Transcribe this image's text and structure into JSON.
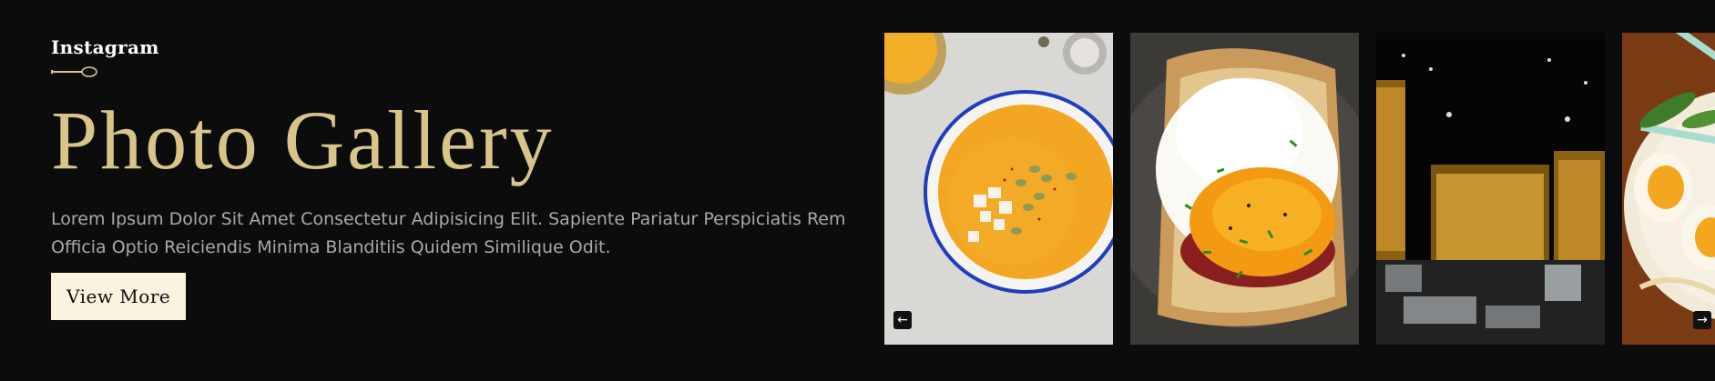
{
  "header": {
    "eyebrow": "Instagram",
    "title": "Photo Gallery",
    "description": "Lorem Ipsum Dolor Sit Amet Consectetur Adipisicing Elit. Sapiente Pariatur Perspiciatis Rem Officia Optio Reiciendis Minima Blanditiis Quidem Similique Odit.",
    "button_label": "View More"
  },
  "gallery": {
    "items": [
      {
        "subject": "pumpkin soup bowl"
      },
      {
        "subject": "fried egg on toast"
      },
      {
        "subject": "iced tea glasses"
      },
      {
        "subject": "ramen bowl with eggs"
      }
    ],
    "prev_icon": "arrow-left-icon",
    "next_icon": "arrow-right-icon"
  },
  "colors": {
    "background": "#0c0c0c",
    "accent": "#d9c489",
    "button_bg": "#faf3de"
  }
}
